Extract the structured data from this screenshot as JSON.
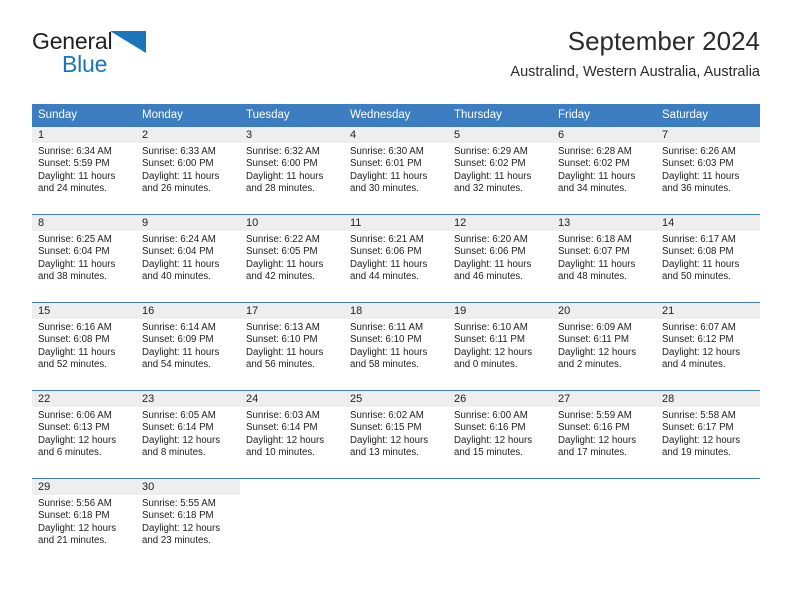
{
  "brand": {
    "name_part1": "General",
    "name_part2": "Blue",
    "triangle_color": "#1b75bb"
  },
  "header": {
    "title": "September 2024",
    "subtitle": "Australind, Western Australia, Australia"
  },
  "colors": {
    "header_blue": "#3b7dc0",
    "day_band_gray": "#eeeeee",
    "text": "#222222"
  },
  "weekdays": [
    "Sunday",
    "Monday",
    "Tuesday",
    "Wednesday",
    "Thursday",
    "Friday",
    "Saturday"
  ],
  "weeks": [
    [
      {
        "day": "1",
        "sunrise": "Sunrise: 6:34 AM",
        "sunset": "Sunset: 5:59 PM",
        "daylight1": "Daylight: 11 hours",
        "daylight2": "and 24 minutes."
      },
      {
        "day": "2",
        "sunrise": "Sunrise: 6:33 AM",
        "sunset": "Sunset: 6:00 PM",
        "daylight1": "Daylight: 11 hours",
        "daylight2": "and 26 minutes."
      },
      {
        "day": "3",
        "sunrise": "Sunrise: 6:32 AM",
        "sunset": "Sunset: 6:00 PM",
        "daylight1": "Daylight: 11 hours",
        "daylight2": "and 28 minutes."
      },
      {
        "day": "4",
        "sunrise": "Sunrise: 6:30 AM",
        "sunset": "Sunset: 6:01 PM",
        "daylight1": "Daylight: 11 hours",
        "daylight2": "and 30 minutes."
      },
      {
        "day": "5",
        "sunrise": "Sunrise: 6:29 AM",
        "sunset": "Sunset: 6:02 PM",
        "daylight1": "Daylight: 11 hours",
        "daylight2": "and 32 minutes."
      },
      {
        "day": "6",
        "sunrise": "Sunrise: 6:28 AM",
        "sunset": "Sunset: 6:02 PM",
        "daylight1": "Daylight: 11 hours",
        "daylight2": "and 34 minutes."
      },
      {
        "day": "7",
        "sunrise": "Sunrise: 6:26 AM",
        "sunset": "Sunset: 6:03 PM",
        "daylight1": "Daylight: 11 hours",
        "daylight2": "and 36 minutes."
      }
    ],
    [
      {
        "day": "8",
        "sunrise": "Sunrise: 6:25 AM",
        "sunset": "Sunset: 6:04 PM",
        "daylight1": "Daylight: 11 hours",
        "daylight2": "and 38 minutes."
      },
      {
        "day": "9",
        "sunrise": "Sunrise: 6:24 AM",
        "sunset": "Sunset: 6:04 PM",
        "daylight1": "Daylight: 11 hours",
        "daylight2": "and 40 minutes."
      },
      {
        "day": "10",
        "sunrise": "Sunrise: 6:22 AM",
        "sunset": "Sunset: 6:05 PM",
        "daylight1": "Daylight: 11 hours",
        "daylight2": "and 42 minutes."
      },
      {
        "day": "11",
        "sunrise": "Sunrise: 6:21 AM",
        "sunset": "Sunset: 6:06 PM",
        "daylight1": "Daylight: 11 hours",
        "daylight2": "and 44 minutes."
      },
      {
        "day": "12",
        "sunrise": "Sunrise: 6:20 AM",
        "sunset": "Sunset: 6:06 PM",
        "daylight1": "Daylight: 11 hours",
        "daylight2": "and 46 minutes."
      },
      {
        "day": "13",
        "sunrise": "Sunrise: 6:18 AM",
        "sunset": "Sunset: 6:07 PM",
        "daylight1": "Daylight: 11 hours",
        "daylight2": "and 48 minutes."
      },
      {
        "day": "14",
        "sunrise": "Sunrise: 6:17 AM",
        "sunset": "Sunset: 6:08 PM",
        "daylight1": "Daylight: 11 hours",
        "daylight2": "and 50 minutes."
      }
    ],
    [
      {
        "day": "15",
        "sunrise": "Sunrise: 6:16 AM",
        "sunset": "Sunset: 6:08 PM",
        "daylight1": "Daylight: 11 hours",
        "daylight2": "and 52 minutes."
      },
      {
        "day": "16",
        "sunrise": "Sunrise: 6:14 AM",
        "sunset": "Sunset: 6:09 PM",
        "daylight1": "Daylight: 11 hours",
        "daylight2": "and 54 minutes."
      },
      {
        "day": "17",
        "sunrise": "Sunrise: 6:13 AM",
        "sunset": "Sunset: 6:10 PM",
        "daylight1": "Daylight: 11 hours",
        "daylight2": "and 56 minutes."
      },
      {
        "day": "18",
        "sunrise": "Sunrise: 6:11 AM",
        "sunset": "Sunset: 6:10 PM",
        "daylight1": "Daylight: 11 hours",
        "daylight2": "and 58 minutes."
      },
      {
        "day": "19",
        "sunrise": "Sunrise: 6:10 AM",
        "sunset": "Sunset: 6:11 PM",
        "daylight1": "Daylight: 12 hours",
        "daylight2": "and 0 minutes."
      },
      {
        "day": "20",
        "sunrise": "Sunrise: 6:09 AM",
        "sunset": "Sunset: 6:11 PM",
        "daylight1": "Daylight: 12 hours",
        "daylight2": "and 2 minutes."
      },
      {
        "day": "21",
        "sunrise": "Sunrise: 6:07 AM",
        "sunset": "Sunset: 6:12 PM",
        "daylight1": "Daylight: 12 hours",
        "daylight2": "and 4 minutes."
      }
    ],
    [
      {
        "day": "22",
        "sunrise": "Sunrise: 6:06 AM",
        "sunset": "Sunset: 6:13 PM",
        "daylight1": "Daylight: 12 hours",
        "daylight2": "and 6 minutes."
      },
      {
        "day": "23",
        "sunrise": "Sunrise: 6:05 AM",
        "sunset": "Sunset: 6:14 PM",
        "daylight1": "Daylight: 12 hours",
        "daylight2": "and 8 minutes."
      },
      {
        "day": "24",
        "sunrise": "Sunrise: 6:03 AM",
        "sunset": "Sunset: 6:14 PM",
        "daylight1": "Daylight: 12 hours",
        "daylight2": "and 10 minutes."
      },
      {
        "day": "25",
        "sunrise": "Sunrise: 6:02 AM",
        "sunset": "Sunset: 6:15 PM",
        "daylight1": "Daylight: 12 hours",
        "daylight2": "and 13 minutes."
      },
      {
        "day": "26",
        "sunrise": "Sunrise: 6:00 AM",
        "sunset": "Sunset: 6:16 PM",
        "daylight1": "Daylight: 12 hours",
        "daylight2": "and 15 minutes."
      },
      {
        "day": "27",
        "sunrise": "Sunrise: 5:59 AM",
        "sunset": "Sunset: 6:16 PM",
        "daylight1": "Daylight: 12 hours",
        "daylight2": "and 17 minutes."
      },
      {
        "day": "28",
        "sunrise": "Sunrise: 5:58 AM",
        "sunset": "Sunset: 6:17 PM",
        "daylight1": "Daylight: 12 hours",
        "daylight2": "and 19 minutes."
      }
    ],
    [
      {
        "day": "29",
        "sunrise": "Sunrise: 5:56 AM",
        "sunset": "Sunset: 6:18 PM",
        "daylight1": "Daylight: 12 hours",
        "daylight2": "and 21 minutes."
      },
      {
        "day": "30",
        "sunrise": "Sunrise: 5:55 AM",
        "sunset": "Sunset: 6:18 PM",
        "daylight1": "Daylight: 12 hours",
        "daylight2": "and 23 minutes."
      },
      {
        "day": "",
        "sunrise": "",
        "sunset": "",
        "daylight1": "",
        "daylight2": ""
      },
      {
        "day": "",
        "sunrise": "",
        "sunset": "",
        "daylight1": "",
        "daylight2": ""
      },
      {
        "day": "",
        "sunrise": "",
        "sunset": "",
        "daylight1": "",
        "daylight2": ""
      },
      {
        "day": "",
        "sunrise": "",
        "sunset": "",
        "daylight1": "",
        "daylight2": ""
      },
      {
        "day": "",
        "sunrise": "",
        "sunset": "",
        "daylight1": "",
        "daylight2": ""
      }
    ]
  ]
}
